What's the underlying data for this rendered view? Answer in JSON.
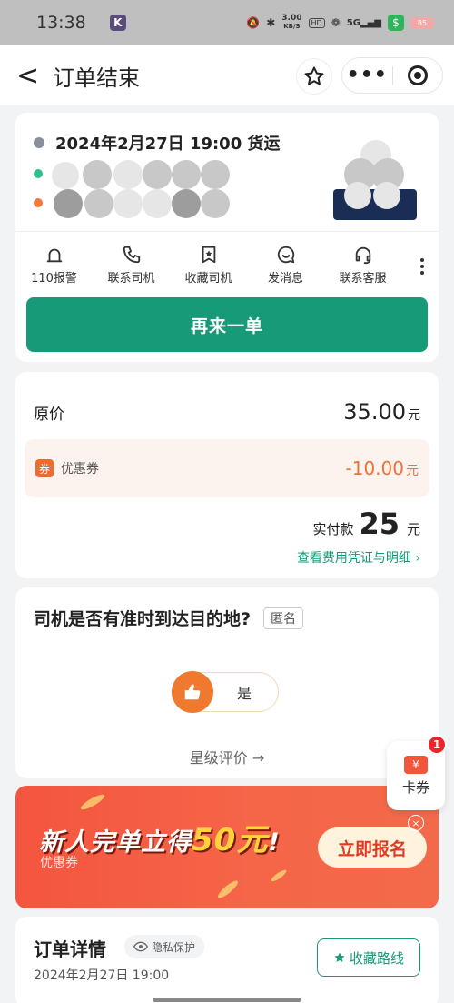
{
  "status_bar": {
    "time": "13:38",
    "app_badge": "K",
    "net_speed": "3.00",
    "net_unit": "KB/S",
    "hd": "HD",
    "signal": "5G",
    "money_icon": "$",
    "battery": "85"
  },
  "nav": {
    "back": "<",
    "title": "订单结束",
    "dots": "•••"
  },
  "order": {
    "datetime": "2024年2月27日 19:00 货运",
    "actions": [
      {
        "label": "110报警",
        "icon": "alarm-icon"
      },
      {
        "label": "联系司机",
        "icon": "phone-icon"
      },
      {
        "label": "收藏司机",
        "icon": "bookmark-star-icon"
      },
      {
        "label": "发消息",
        "icon": "chat-icon"
      },
      {
        "label": "联系客服",
        "icon": "headset-icon"
      }
    ],
    "reorder_label": "再来一单"
  },
  "price": {
    "original_label": "原价",
    "original_value": "35.00",
    "yuan": "元",
    "coupon_badge": "券",
    "coupon_label": "优惠券",
    "coupon_value": "-10.00",
    "paid_label": "实付款",
    "paid_value": "25",
    "details_link": "查看费用凭证与明细 ›"
  },
  "ontime": {
    "question": "司机是否有准时到达目的地?",
    "anon": "匿名",
    "yes": "是",
    "star_link": "星级评价 →"
  },
  "banner": {
    "text_a": "新人完单立得",
    "text_hl": "50元",
    "text_b": "!",
    "sub": "优惠券",
    "cta": "立即报名",
    "close": "×"
  },
  "float_coupon": {
    "icon": "¥",
    "label": "卡券",
    "badge": "1"
  },
  "detail": {
    "title": "订单详情",
    "privacy": "隐私保护",
    "date": "2024年2月27日 19:00",
    "fav_route": "收藏路线"
  },
  "colors": {
    "accent": "#169a78",
    "orange": "#f0703a",
    "banner_red": "#f4553f"
  }
}
